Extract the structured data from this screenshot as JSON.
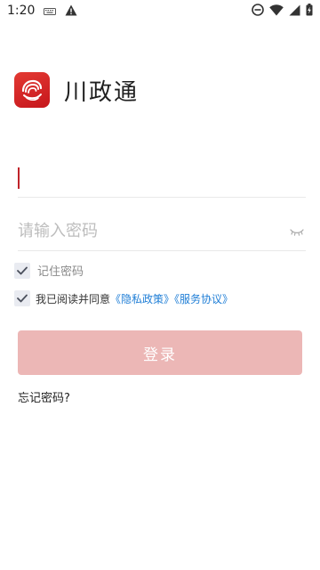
{
  "status_bar": {
    "time": "1:20",
    "icons": [
      "keyboard-icon",
      "warning-icon",
      "do-not-disturb-icon",
      "wifi-icon",
      "signal-icon",
      "battery-charging-icon"
    ]
  },
  "app": {
    "title": "川政通",
    "logo_colors": {
      "primary": "#e33a33",
      "dark": "#c6161c"
    }
  },
  "username": {
    "value": "",
    "placeholder": ""
  },
  "password": {
    "value": "",
    "placeholder": "请输入密码"
  },
  "remember": {
    "label": "记住密码",
    "checked": true
  },
  "agreement": {
    "checked": true,
    "prefix": "我已阅读并同意",
    "privacy_link": "《隐私政策》",
    "service_link": "《服务协议》"
  },
  "login_button": {
    "label": "登录",
    "enabled": false,
    "color": "#ecb7b6"
  },
  "forgot_password": {
    "label": "忘记密码?"
  },
  "colors": {
    "link": "#1f7ed6",
    "caret": "#c0232a"
  }
}
